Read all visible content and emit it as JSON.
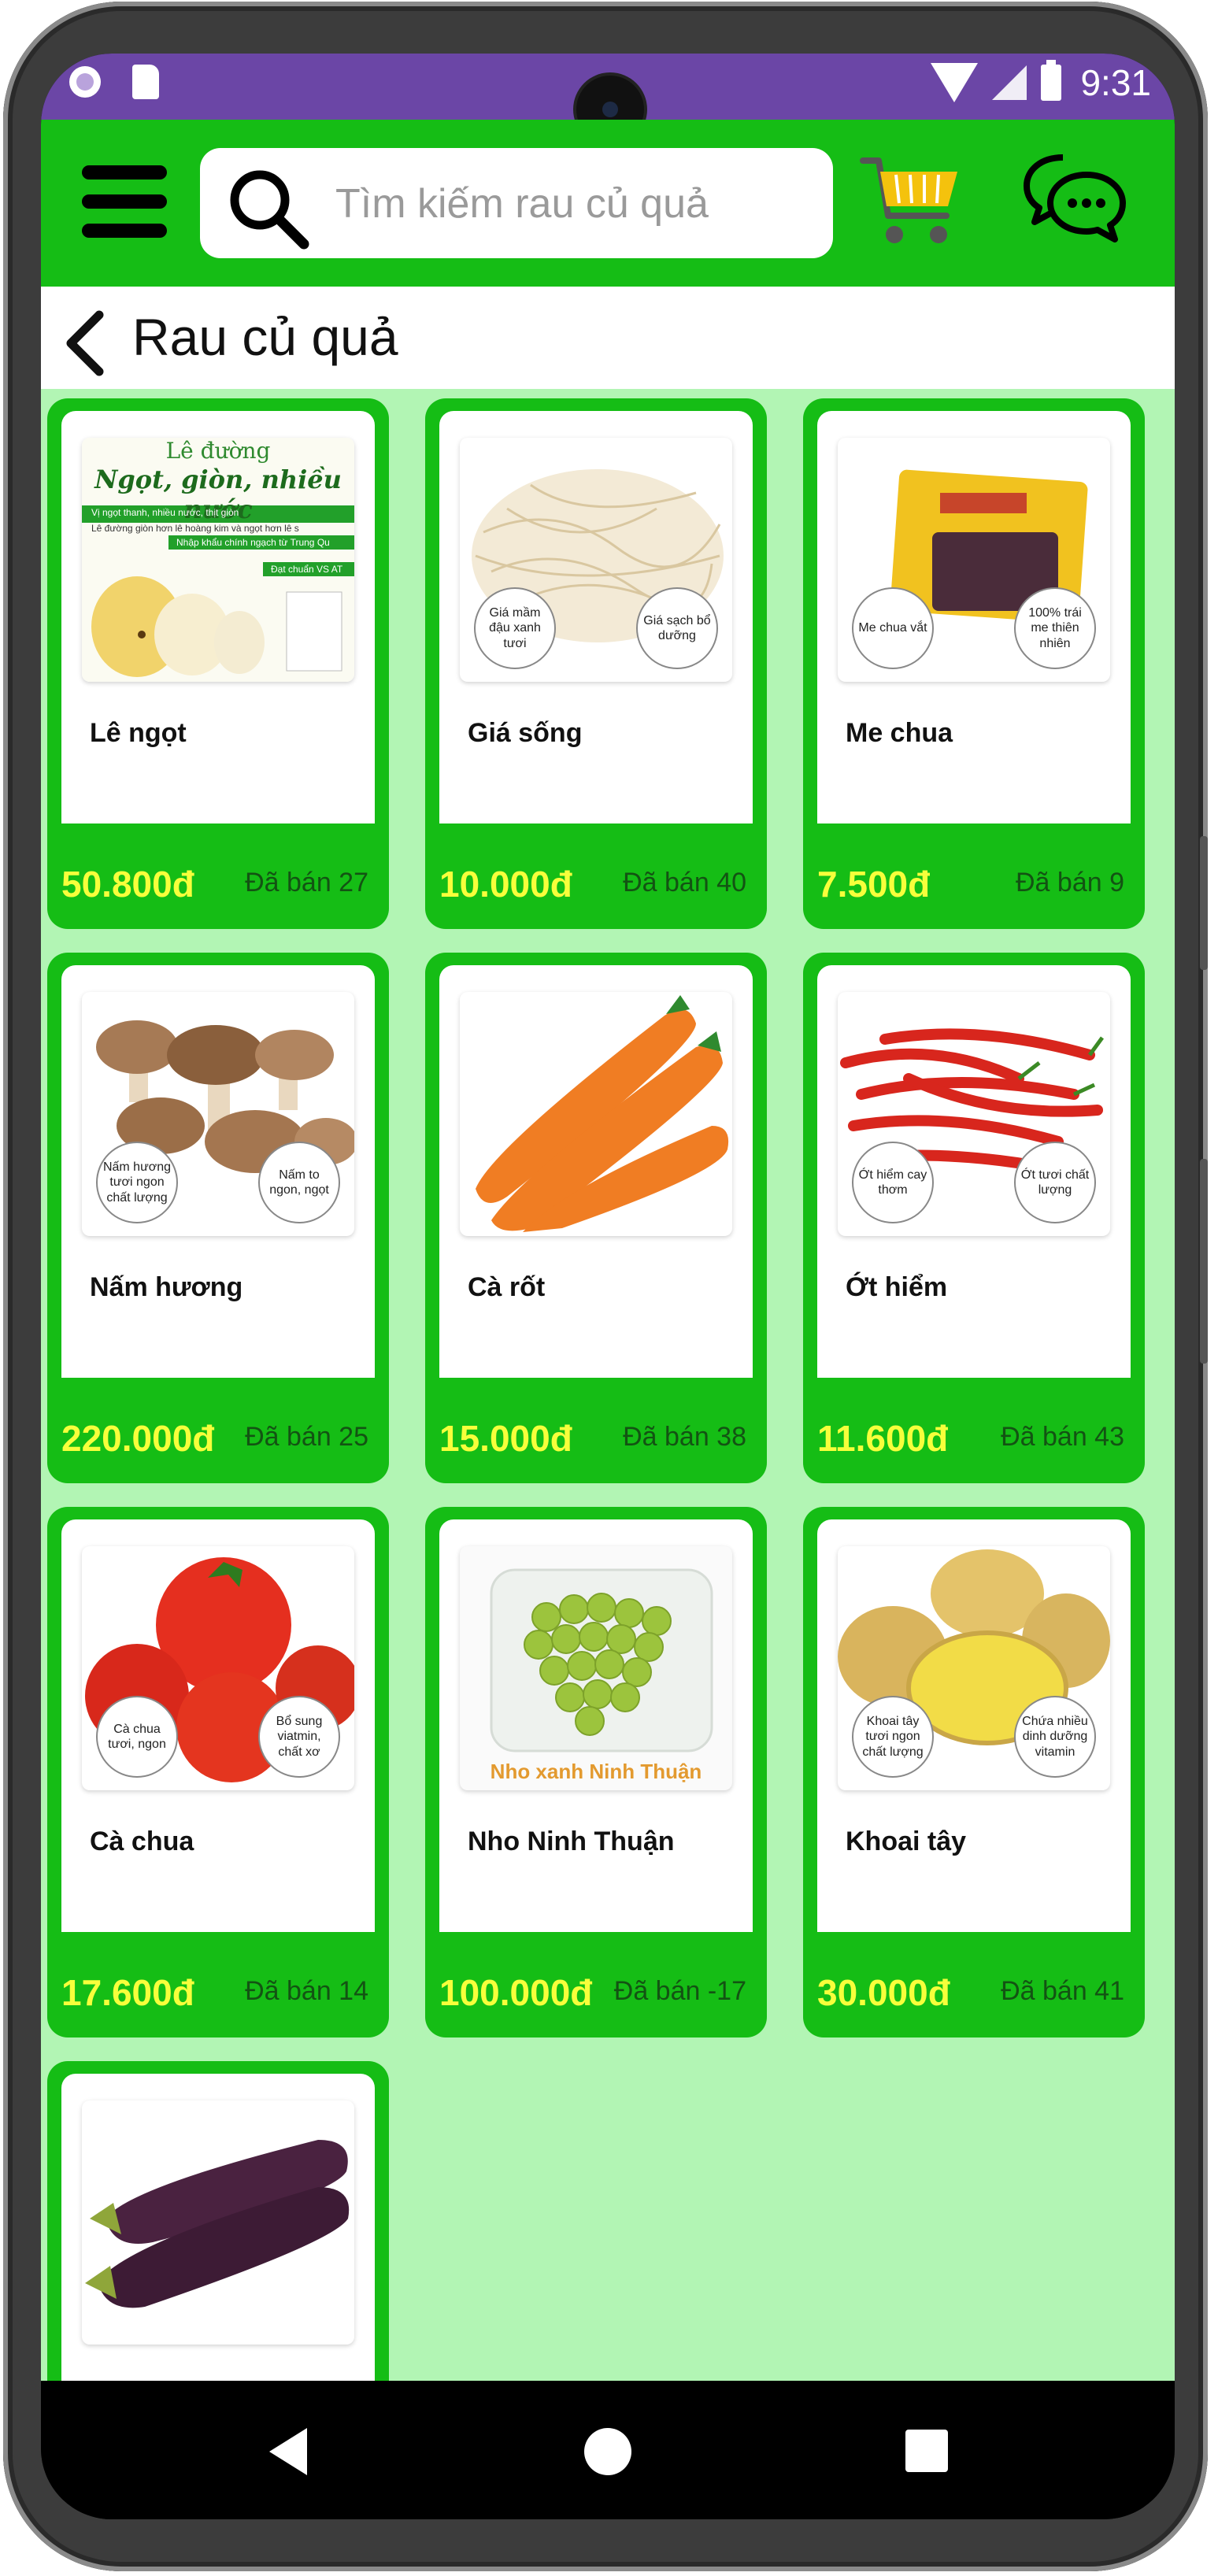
{
  "status_bar": {
    "time": "9:31"
  },
  "header": {
    "search_placeholder": "Tìm kiếm rau củ quả",
    "accent_color": "#15bd15"
  },
  "page": {
    "title": "Rau củ quả"
  },
  "products": [
    {
      "name": "Lê ngọt",
      "price": "50.800đ",
      "sold": "Đã bán 27",
      "image": "pear",
      "image_text": {
        "title": "Lê đường",
        "headline": "Ngọt, giòn, nhiều nước",
        "bullet1": "Vị ngọt thanh, nhiều nước, thịt giòn",
        "bullet2": "Lê đường giòn hơn lê hoàng kim và ngọt hơn lê s",
        "note1": "Nhập khẩu chính ngạch từ Trung Qu",
        "note2": "Đạt chuẩn VS AT"
      }
    },
    {
      "name": "Giá sống",
      "price": "10.000đ",
      "sold": "Đã bán 40",
      "image": "bean-sprouts",
      "badges": [
        "Giá mầm đậu xanh tươi",
        "Giá sạch bổ dưỡng"
      ]
    },
    {
      "name": "Me chua",
      "price": "7.500đ",
      "sold": "Đã bán 9",
      "image": "tamarind",
      "badges": [
        "Me chua vắt",
        "100% trái me thiên nhiên"
      ]
    },
    {
      "name": "Nấm hương",
      "price": "220.000đ",
      "sold": "Đã bán 25",
      "image": "mushrooms",
      "badges": [
        "Nấm hương tươi ngon chất lượng",
        "Nấm to ngon, ngọt"
      ]
    },
    {
      "name": "Cà rốt",
      "price": "15.000đ",
      "sold": "Đã bán 38",
      "image": "carrots"
    },
    {
      "name": "Ớt hiểm",
      "price": "11.600đ",
      "sold": "Đã bán 43",
      "image": "chili",
      "badges": [
        "Ớt hiểm cay thơm",
        "Ớt tươi chất lượng"
      ]
    },
    {
      "name": "Cà chua",
      "price": "17.600đ",
      "sold": "Đã bán 14",
      "image": "tomatoes",
      "badges": [
        "Cà chua tươi, ngon",
        "Bổ sung viatmin, chất xơ"
      ]
    },
    {
      "name": "Nho Ninh Thuận",
      "price": "100.000đ",
      "sold": "Đã bán -17",
      "image": "grapes",
      "image_label": "Nho xanh Ninh Thuận"
    },
    {
      "name": "Khoai tây",
      "price": "30.000đ",
      "sold": "Đã bán 41",
      "image": "potatoes",
      "badges": [
        "Khoai tây tươi ngon chất lượng",
        "Chứa nhiều dinh dưỡng vitamin"
      ]
    },
    {
      "name": "",
      "price": "",
      "sold": "",
      "image": "eggplant"
    }
  ]
}
